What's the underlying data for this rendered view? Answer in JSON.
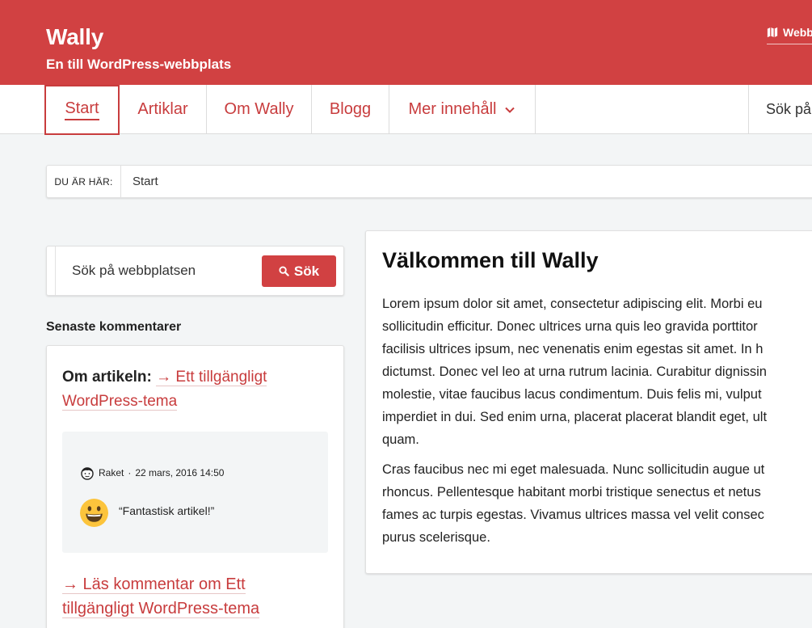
{
  "header": {
    "site_title": "Wally",
    "site_description": "En till WordPress-webbplats",
    "top_link": "Webb"
  },
  "nav": {
    "items": [
      {
        "label": "Start"
      },
      {
        "label": "Artiklar"
      },
      {
        "label": "Om Wally"
      },
      {
        "label": "Blogg"
      },
      {
        "label": "Mer innehåll"
      }
    ],
    "search_label": "Sök på"
  },
  "breadcrumb": {
    "label": "DU ÄR HÄR:",
    "current": "Start"
  },
  "sidebar": {
    "search_placeholder": "Sök på webbplatsen",
    "search_button": "Sök",
    "widget_title": "Senaste kommentarer",
    "comment": {
      "prefix": "Om artikeln:",
      "article_link": "→ Ett tillgängligt WordPress-tema",
      "author": "Raket",
      "separator": "·",
      "date": "22 mars, 2016 14:50",
      "text": "“Fantastisk artikel!”",
      "read_more": "→ Läs kommentar om Ett tillgängligt WordPress-tema"
    }
  },
  "article": {
    "title": "Välkommen till Wally",
    "paragraph1": "Lorem ipsum dolor sit amet, consectetur adipiscing elit. Morbi eu\nsollicitudin efficitur. Donec ultrices urna quis leo gravida porttitor\nfacilisis ultrices ipsum, nec venenatis enim egestas sit amet. In h\ndictumst. Donec vel leo at urna rutrum lacinia. Curabitur dignissin\nmolestie, vitae faucibus lacus condimentum. Duis felis mi, vulput\nimperdiet in dui. Sed enim urna, placerat placerat blandit eget, ult\nquam.",
    "paragraph2": "Cras faucibus nec mi eget malesuada. Nunc sollicitudin augue ut\nrhoncus. Pellentesque habitant morbi tristique senectus et netus\nfames ac turpis egestas. Vivamus ultrices massa vel velit consec\npurus scelerisque."
  },
  "colors": {
    "brand": "#d14142",
    "link": "#c83c3d",
    "background": "#f3f5f6"
  },
  "icons": {
    "top_link": "map-icon",
    "nav_more": "chevron-down-icon",
    "search_button": "search-icon",
    "avatar": "avatar-icon",
    "comment_emoji": "smiley-emoji-icon"
  }
}
